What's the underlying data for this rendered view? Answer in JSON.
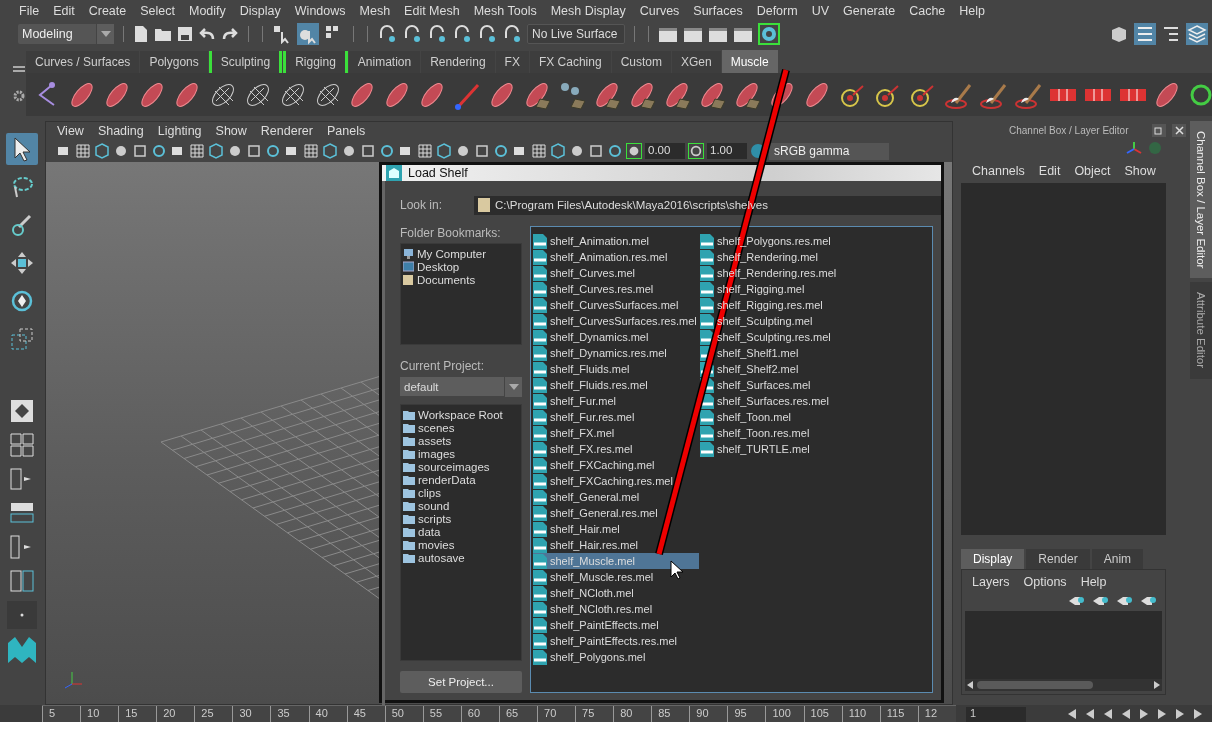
{
  "menu_bar": [
    "File",
    "Edit",
    "Create",
    "Select",
    "Modify",
    "Display",
    "Windows",
    "Mesh",
    "Edit Mesh",
    "Mesh Tools",
    "Mesh Display",
    "Curves",
    "Surfaces",
    "Deform",
    "UV",
    "Generate",
    "Cache",
    "Help"
  ],
  "status_line": {
    "mode": "Modeling",
    "live_surface": "No Live Surface"
  },
  "shelf_tabs": [
    {
      "label": "Curves / Surfaces",
      "selected": false,
      "marked": false
    },
    {
      "label": "Polygons",
      "selected": false,
      "marked": false
    },
    {
      "label": "Sculpting",
      "selected": false,
      "marked": true
    },
    {
      "label": "Rigging",
      "selected": false,
      "marked": true
    },
    {
      "label": "Animation",
      "selected": false,
      "marked": false
    },
    {
      "label": "Rendering",
      "selected": false,
      "marked": false
    },
    {
      "label": "FX",
      "selected": false,
      "marked": false
    },
    {
      "label": "FX Caching",
      "selected": false,
      "marked": false
    },
    {
      "label": "Custom",
      "selected": false,
      "marked": false
    },
    {
      "label": "XGen",
      "selected": false,
      "marked": false
    },
    {
      "label": "Muscle",
      "selected": true,
      "marked": false
    }
  ],
  "toolbox": [
    {
      "kind": "select",
      "selected": true
    },
    {
      "kind": "lasso",
      "selected": false
    },
    {
      "kind": "paint",
      "selected": false
    },
    {
      "kind": "move",
      "selected": false
    },
    {
      "kind": "rotate",
      "selected": false
    },
    {
      "kind": "scale",
      "selected": false
    }
  ],
  "viewport": {
    "menu": [
      "View",
      "Shading",
      "Lighting",
      "Show",
      "Renderer",
      "Panels"
    ],
    "exposure": "0.00",
    "gamma": "1.00",
    "color_space": "sRGB gamma"
  },
  "dialog": {
    "title": "Load Shelf",
    "look_in_label": "Look in:",
    "path": "C:\\Program Files\\Autodesk\\Maya2016\\scripts\\shelves",
    "bookmarks_label": "Folder Bookmarks:",
    "bookmarks": [
      {
        "label": "My Computer",
        "kind": "computer"
      },
      {
        "label": "Desktop",
        "kind": "desktop"
      },
      {
        "label": "Documents",
        "kind": "documents"
      }
    ],
    "project_label": "Current Project:",
    "project": "default",
    "folders": [
      "Workspace Root",
      "scenes",
      "assets",
      "images",
      "sourceimages",
      "renderData",
      "clips",
      "sound",
      "scripts",
      "data",
      "movies",
      "autosave"
    ],
    "set_project": "Set Project...",
    "files": [
      {
        "name": "shelf_Animation.mel",
        "selected": false
      },
      {
        "name": "shelf_Animation.res.mel",
        "selected": false
      },
      {
        "name": "shelf_Curves.mel",
        "selected": false
      },
      {
        "name": "shelf_Curves.res.mel",
        "selected": false
      },
      {
        "name": "shelf_CurvesSurfaces.mel",
        "selected": false
      },
      {
        "name": "shelf_CurvesSurfaces.res.mel",
        "selected": false
      },
      {
        "name": "shelf_Dynamics.mel",
        "selected": false
      },
      {
        "name": "shelf_Dynamics.res.mel",
        "selected": false
      },
      {
        "name": "shelf_Fluids.mel",
        "selected": false
      },
      {
        "name": "shelf_Fluids.res.mel",
        "selected": false
      },
      {
        "name": "shelf_Fur.mel",
        "selected": false
      },
      {
        "name": "shelf_Fur.res.mel",
        "selected": false
      },
      {
        "name": "shelf_FX.mel",
        "selected": false
      },
      {
        "name": "shelf_FX.res.mel",
        "selected": false
      },
      {
        "name": "shelf_FXCaching.mel",
        "selected": false
      },
      {
        "name": "shelf_FXCaching.res.mel",
        "selected": false
      },
      {
        "name": "shelf_General.mel",
        "selected": false
      },
      {
        "name": "shelf_General.res.mel",
        "selected": false
      },
      {
        "name": "shelf_Hair.mel",
        "selected": false
      },
      {
        "name": "shelf_Hair.res.mel",
        "selected": false
      },
      {
        "name": "shelf_Muscle.mel",
        "selected": true
      },
      {
        "name": "shelf_Muscle.res.mel",
        "selected": false
      },
      {
        "name": "shelf_NCloth.mel",
        "selected": false
      },
      {
        "name": "shelf_NCloth.res.mel",
        "selected": false
      },
      {
        "name": "shelf_PaintEffects.mel",
        "selected": false
      },
      {
        "name": "shelf_PaintEffects.res.mel",
        "selected": false
      },
      {
        "name": "shelf_Polygons.mel",
        "selected": false
      },
      {
        "name": "shelf_Polygons.res.mel",
        "selected": false
      },
      {
        "name": "shelf_Rendering.mel",
        "selected": false
      },
      {
        "name": "shelf_Rendering.res.mel",
        "selected": false
      },
      {
        "name": "shelf_Rigging.mel",
        "selected": false
      },
      {
        "name": "shelf_Rigging.res.mel",
        "selected": false
      },
      {
        "name": "shelf_Sculpting.mel",
        "selected": false
      },
      {
        "name": "shelf_Sculpting.res.mel",
        "selected": false
      },
      {
        "name": "shelf_Shelf1.mel",
        "selected": false
      },
      {
        "name": "shelf_Shelf2.mel",
        "selected": false
      },
      {
        "name": "shelf_Surfaces.mel",
        "selected": false
      },
      {
        "name": "shelf_Surfaces.res.mel",
        "selected": false
      },
      {
        "name": "shelf_Toon.mel",
        "selected": false
      },
      {
        "name": "shelf_Toon.res.mel",
        "selected": false
      },
      {
        "name": "shelf_TURTLE.mel",
        "selected": false
      }
    ]
  },
  "channel_box": {
    "title": "Channel Box / Layer Editor",
    "menu": [
      "Channels",
      "Edit",
      "Object",
      "Show"
    ],
    "layer_tabs": [
      {
        "label": "Display",
        "selected": true
      },
      {
        "label": "Render",
        "selected": false
      },
      {
        "label": "Anim",
        "selected": false
      }
    ],
    "layer_menu": [
      "Layers",
      "Options",
      "Help"
    ]
  },
  "side_tabs": [
    {
      "label": "Channel Box / Layer Editor",
      "selected": true
    },
    {
      "label": "Attribute Editor",
      "selected": false
    }
  ],
  "timeline": {
    "ticks": [
      "5",
      "10",
      "15",
      "20",
      "25",
      "30",
      "35",
      "40",
      "45",
      "50",
      "55",
      "60",
      "65",
      "70",
      "75",
      "80",
      "85",
      "90",
      "95",
      "100",
      "105",
      "110",
      "115",
      "12"
    ],
    "current_frame": "1"
  }
}
